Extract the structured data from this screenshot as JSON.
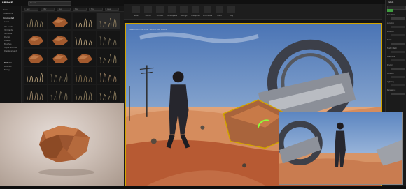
{
  "bridge": {
    "app_title": "BRIDGE",
    "search_placeholder": "Search",
    "sidebar": {
      "items": [
        {
          "label": "Home"
        },
        {
          "label": "Collections"
        },
        {
          "label": "Downloaded"
        },
        {
          "label": "Local"
        },
        {
          "label": "3D Assets"
        },
        {
          "label": "3D Plants"
        },
        {
          "label": "Surfaces"
        },
        {
          "label": "Decals"
        },
        {
          "label": "Atlases"
        },
        {
          "label": "Brushes"
        },
        {
          "label": "Imperfections"
        },
        {
          "label": "Displacement"
        },
        {
          "label": "Textures"
        },
        {
          "label": "Brushes"
        },
        {
          "label": "Foliage"
        }
      ]
    },
    "filters": [
      "Sort",
      "Filter",
      "Tags",
      "Size",
      "Type",
      "View"
    ],
    "thumbnails": [
      {
        "icon": "foliage-icon"
      },
      {
        "icon": "rock-icon"
      },
      {
        "icon": "flower-icon"
      },
      {
        "icon": "foliage-icon"
      },
      {
        "icon": "rock-icon"
      },
      {
        "icon": "rock-icon"
      },
      {
        "icon": "flower-icon"
      },
      {
        "icon": "shrub-icon"
      },
      {
        "icon": "rock-icon"
      },
      {
        "icon": "rock-icon"
      },
      {
        "icon": "rock-icon"
      },
      {
        "icon": "foliage-icon"
      },
      {
        "icon": "flower-icon"
      },
      {
        "icon": "shrub-icon"
      },
      {
        "icon": "leaves-icon"
      },
      {
        "icon": "stones-icon"
      },
      {
        "icon": "pebbles-icon"
      },
      {
        "icon": "shrub-icon"
      },
      {
        "icon": "foliage-icon"
      },
      {
        "icon": "foliage-icon"
      }
    ],
    "preview": {
      "icon": "rock-icon"
    }
  },
  "unreal": {
    "toolbar": [
      {
        "label": "Save"
      },
      {
        "label": "Source"
      },
      {
        "label": "Content"
      },
      {
        "label": "Marketplace"
      },
      {
        "label": "Settings"
      },
      {
        "label": "Blueprints"
      },
      {
        "label": "Cinematics"
      },
      {
        "label": "Build"
      },
      {
        "label": "Play"
      }
    ],
    "viewport_overlay": "SELECTED ACTOR  ·  LIGHTING BUILD",
    "details": {
      "title": "Details",
      "rows": [
        {
          "label": "Transform"
        },
        {
          "label": "Location"
        },
        {
          "label": "Rotation"
        },
        {
          "label": "Scale"
        },
        {
          "label": "Static Mesh"
        },
        {
          "label": "Materials"
        },
        {
          "label": "Physics"
        },
        {
          "label": "Collision"
        },
        {
          "label": "Lighting"
        },
        {
          "label": "Rendering"
        }
      ]
    },
    "status": "Speed: 4"
  },
  "colors": {
    "accent_selection": "#d2a400",
    "sky": "#6b91c4",
    "sand": "#d98b55",
    "rock": "#a9643c"
  }
}
